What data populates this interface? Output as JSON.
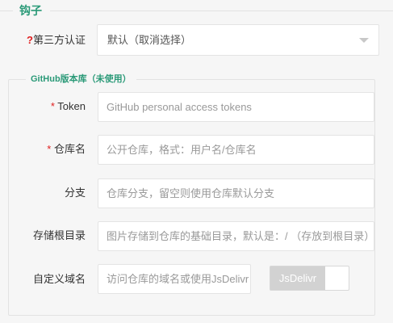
{
  "section": {
    "title": "钩子"
  },
  "third_party_auth": {
    "label_mark": "?",
    "label": "第三方认证",
    "selected": "默认（取消选择）"
  },
  "github": {
    "legend": "GitHub版本库（未使用）",
    "token": {
      "label": "Token",
      "required_mark": "*",
      "placeholder": "GitHub personal access tokens"
    },
    "repo": {
      "label": "仓库名",
      "required_mark": "*",
      "placeholder": "公开仓库，格式：用户名/仓库名"
    },
    "branch": {
      "label": "分支",
      "placeholder": "仓库分支，留空则使用仓库默认分支"
    },
    "root_dir": {
      "label": "存储根目录",
      "placeholder": "图片存储到仓库的基础目录，默认是：/ （存放到根目录）"
    },
    "custom_domain": {
      "label": "自定义域名",
      "placeholder": "访问仓库的域名或使用JsDelivr",
      "toggle_label": "JsDelivr",
      "toggle_on": true
    }
  },
  "colors": {
    "accent": "#2b9a78",
    "required": "#e02020"
  }
}
